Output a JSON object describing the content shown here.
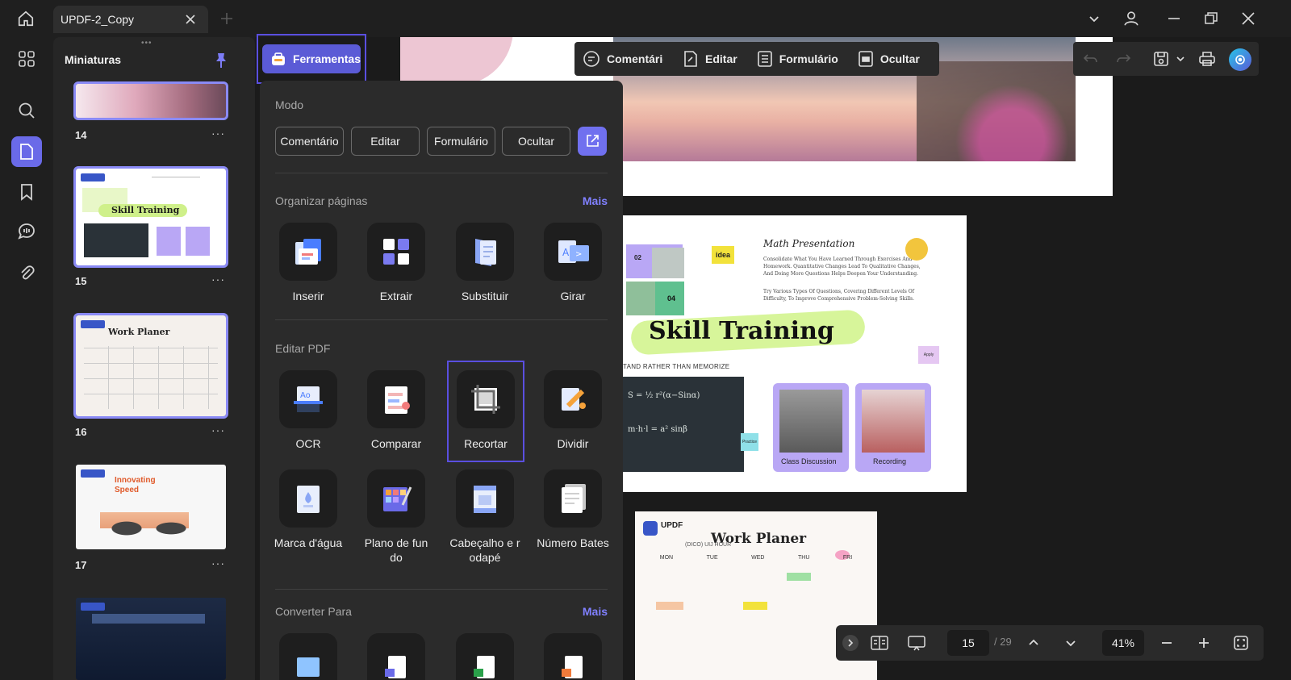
{
  "titlebar": {
    "tab_title": "UPDF-2_Copy"
  },
  "thumbnails": {
    "title": "Miniaturas",
    "pages": [
      {
        "num": "14"
      },
      {
        "num": "15"
      },
      {
        "num": "16"
      },
      {
        "num": "17"
      }
    ],
    "more": "···"
  },
  "toolbar": {
    "tools_label": "Ferramentas",
    "modes": [
      "Comentário",
      "Editar",
      "Formulário",
      "Ocultar"
    ]
  },
  "panel": {
    "mode_title": "Modo",
    "mode_buttons": [
      "Comentário",
      "Editar",
      "Formulário",
      "Ocultar"
    ],
    "organize_title": "Organizar páginas",
    "organize_more": "Mais",
    "organize_tools": [
      "Inserir",
      "Extrair",
      "Substituir",
      "Girar"
    ],
    "edit_title": "Editar PDF",
    "edit_tools": [
      "OCR",
      "Comparar",
      "Recortar",
      "Dividir"
    ],
    "edit_tools_2": [
      "Marca d'água",
      "Plano de fun do",
      "Cabeçalho e r odapé",
      "Número Bates"
    ],
    "convert_title": "Converter Para",
    "convert_more": "Mais"
  },
  "page15": {
    "math_title": "Math Presentation",
    "math_text1": "Consolidate What You Have Learned Through Exercises And Homework. Quantitative Changes Lead To Qualitative Changes, And Doing More Questions Helps Deepen Your Understanding.",
    "math_text2": "Try Various Types Of Questions, Covering Different Levels Of Difficulty, To Improve Comprehensive Problem-Solving Skills.",
    "headline": "Skill Training",
    "subline": "TAND RATHER THAN MEMORIZE",
    "idea": "idea",
    "n02": "02",
    "n04": "04",
    "apply": "Apply",
    "practice": "Practice",
    "photo1": "Class Discussion",
    "photo2": "Recording"
  },
  "page16": {
    "brand": "UPDF",
    "title": "Work Planer",
    "subtitle": "(DICO) UIJ HOUR",
    "days": [
      "MON",
      "TUE",
      "WED",
      "THU",
      "FRI"
    ]
  },
  "bottombar": {
    "page": "15",
    "total": "/ 29",
    "zoom": "41%"
  },
  "colors": {
    "accent": "#5b5bd6",
    "accent_light": "#8080ff",
    "panel_bg": "#2b2b2b",
    "lime": "#c9f56b",
    "lavender": "#b9a7f5"
  }
}
